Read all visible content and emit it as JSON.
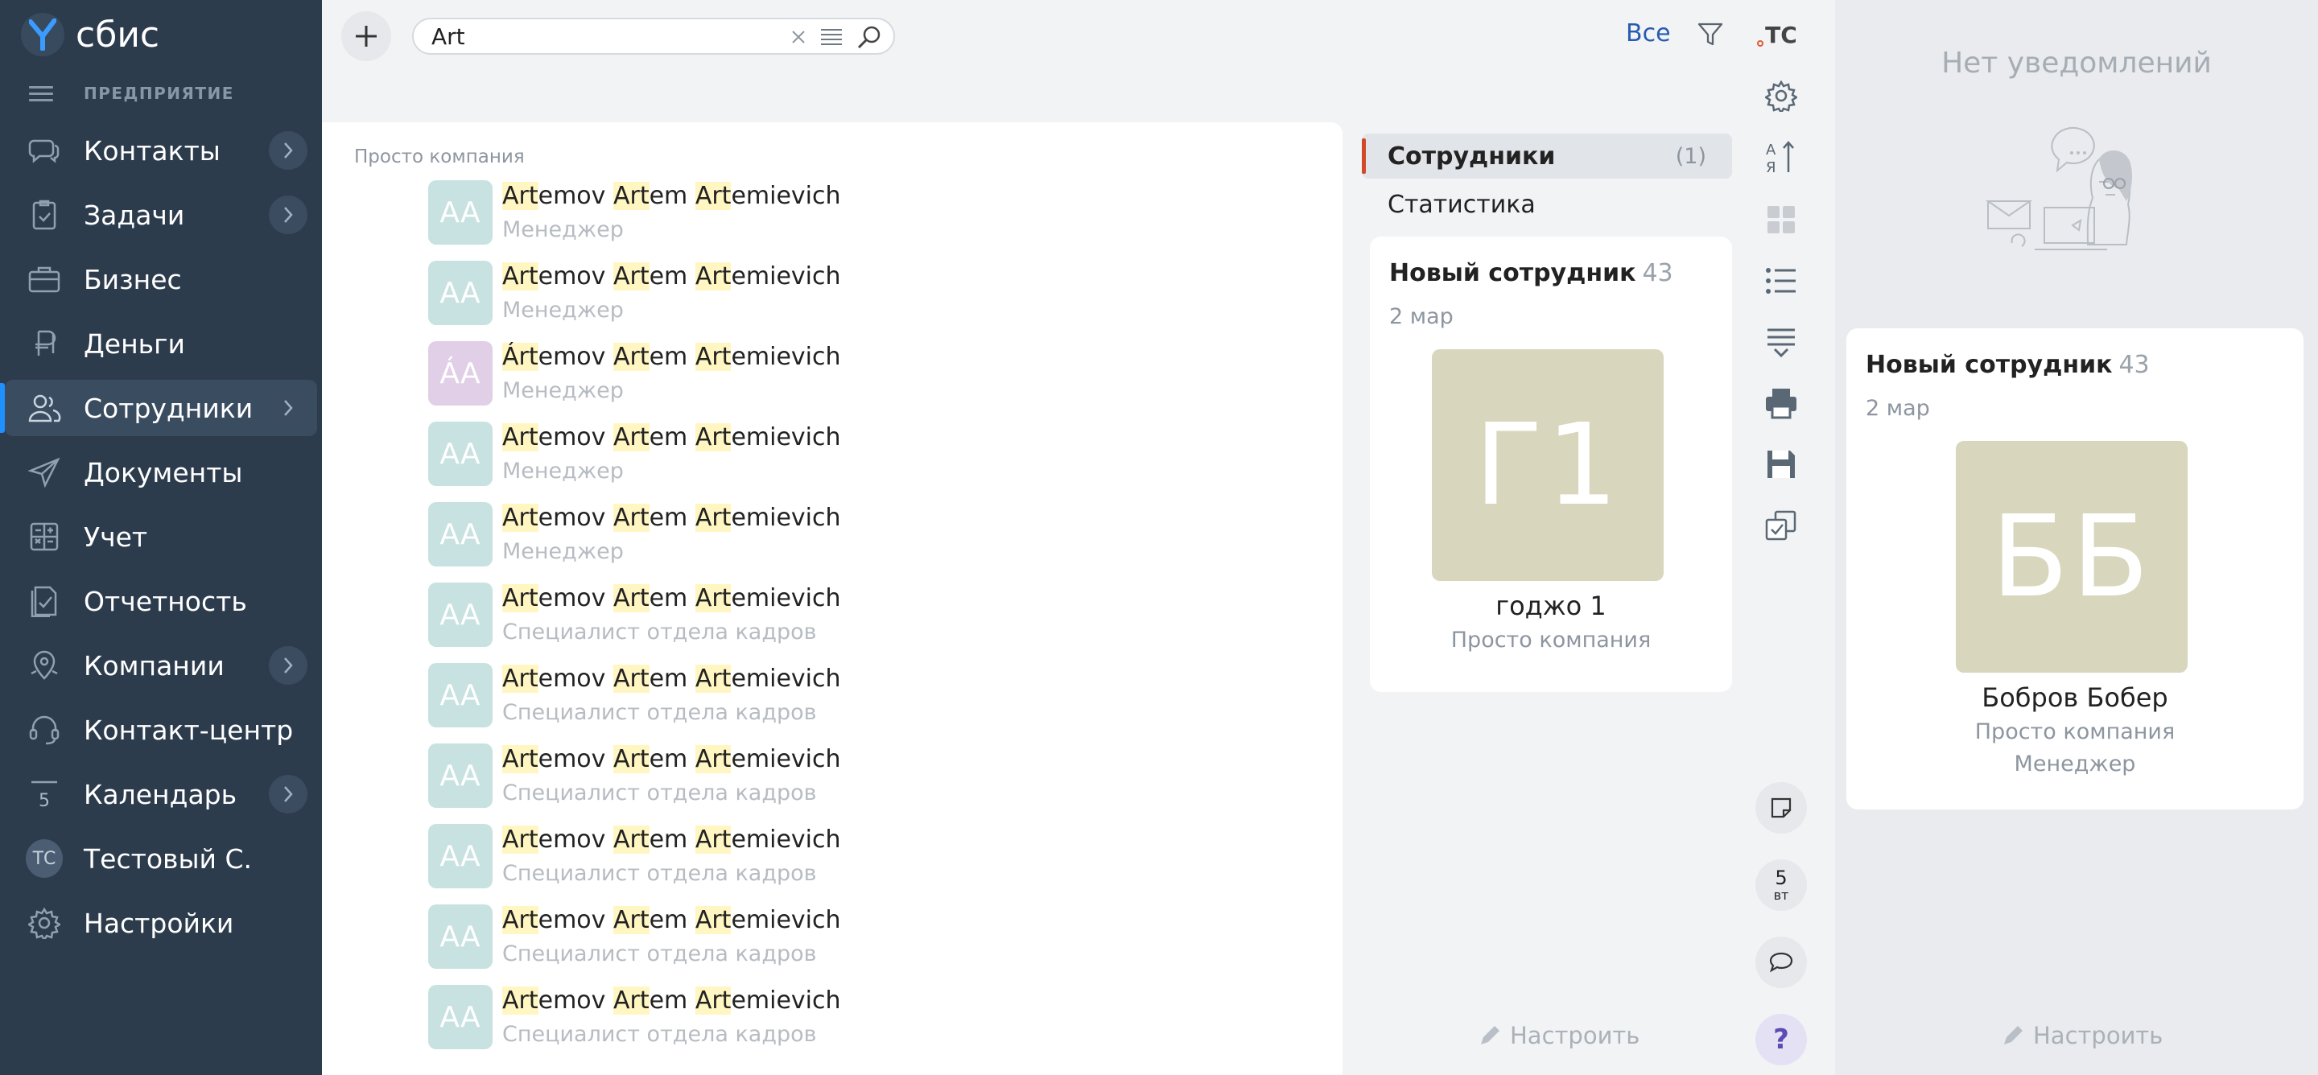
{
  "app": {
    "logo_text": "сбис",
    "org_label": "ПРЕДПРИЯТИЕ"
  },
  "sidebar": {
    "items": [
      {
        "label": "Контакты",
        "icon": "chat-bubbles-icon",
        "chevron": true
      },
      {
        "label": "Задачи",
        "icon": "task-clipboard-icon",
        "chevron": true
      },
      {
        "label": "Бизнес",
        "icon": "briefcase-icon",
        "chevron": false
      },
      {
        "label": "Деньги",
        "icon": "ruble-icon",
        "chevron": false
      },
      {
        "label": "Сотрудники",
        "icon": "employees-icon",
        "chevron": true,
        "active": true
      },
      {
        "label": "Документы",
        "icon": "paper-plane-icon",
        "chevron": false
      },
      {
        "label": "Учет",
        "icon": "calculator-icon",
        "chevron": false
      },
      {
        "label": "Отчетность",
        "icon": "report-check-icon",
        "chevron": false
      },
      {
        "label": "Компании",
        "icon": "map-pin-icon",
        "chevron": true
      },
      {
        "label": "Контакт-центр",
        "icon": "headset-icon",
        "chevron": false
      },
      {
        "label": "Календарь",
        "icon": "calendar-icon",
        "chevron": true,
        "icon_text": "5"
      },
      {
        "label": "Тестовый С.",
        "icon": "avatar",
        "chevron": false,
        "icon_text": "ТС"
      },
      {
        "label": "Настройки",
        "icon": "gear-icon",
        "chevron": false
      }
    ]
  },
  "search": {
    "value": "Art",
    "filter_label": "Все"
  },
  "results": {
    "group_title": "Просто компания",
    "rows": [
      {
        "initials": "АА",
        "first": "Art",
        "first_rest": "emov",
        "mid": "Art",
        "mid_rest": "em",
        "last": "Art",
        "last_rest": "emievich",
        "position": "Менеджер",
        "purple": false
      },
      {
        "initials": "АА",
        "first": "Art",
        "first_rest": "emov",
        "mid": "Art",
        "mid_rest": "em",
        "last": "Art",
        "last_rest": "emievich",
        "position": "Менеджер",
        "purple": false
      },
      {
        "initials": "ÁА",
        "first": "Árt",
        "first_rest": "emov",
        "mid": "Art",
        "mid_rest": "em",
        "last": "Art",
        "last_rest": "emievich",
        "position": "Менеджер",
        "purple": true
      },
      {
        "initials": "АА",
        "first": "Art",
        "first_rest": "emov",
        "mid": "Art",
        "mid_rest": "em",
        "last": "Art",
        "last_rest": "emievich",
        "position": "Менеджер",
        "purple": false
      },
      {
        "initials": "АА",
        "first": "Art",
        "first_rest": "emov",
        "mid": "Art",
        "mid_rest": "em",
        "last": "Art",
        "last_rest": "emievich",
        "position": "Менеджер",
        "purple": false
      },
      {
        "initials": "АА",
        "first": "Art",
        "first_rest": "emov",
        "mid": "Art",
        "mid_rest": "em",
        "last": "Art",
        "last_rest": "emievich",
        "position": "Специалист отдела кадров",
        "purple": false
      },
      {
        "initials": "АА",
        "first": "Art",
        "first_rest": "emov",
        "mid": "Art",
        "mid_rest": "em",
        "last": "Art",
        "last_rest": "emievich",
        "position": "Специалист отдела кадров",
        "purple": false
      },
      {
        "initials": "АА",
        "first": "Art",
        "first_rest": "emov",
        "mid": "Art",
        "mid_rest": "em",
        "last": "Art",
        "last_rest": "emievich",
        "position": "Специалист отдела кадров",
        "purple": false
      },
      {
        "initials": "АА",
        "first": "Art",
        "first_rest": "emov",
        "mid": "Art",
        "mid_rest": "em",
        "last": "Art",
        "last_rest": "emievich",
        "position": "Специалист отдела кадров",
        "purple": false
      },
      {
        "initials": "АА",
        "first": "Art",
        "first_rest": "emov",
        "mid": "Art",
        "mid_rest": "em",
        "last": "Art",
        "last_rest": "emievich",
        "position": "Специалист отдела кадров",
        "purple": false
      },
      {
        "initials": "АА",
        "first": "Art",
        "first_rest": "emov",
        "mid": "Art",
        "mid_rest": "em",
        "last": "Art",
        "last_rest": "emievich",
        "position": "Специалист отдела кадров",
        "purple": false
      }
    ]
  },
  "facets": {
    "employees_label": "Сотрудники",
    "employees_count": "(1)",
    "stats_label": "Статистика"
  },
  "new_employee_card": {
    "title": "Новый сотрудник",
    "count": "43",
    "date": "2 мар",
    "photo_initials": "Г1",
    "name": "годжо 1",
    "company": "Просто компания"
  },
  "configure_label": "Настроить",
  "toolbar": {
    "user_initials": "ТС",
    "date_day": "5",
    "date_weekday": "вт",
    "help_label": "?"
  },
  "notifications": {
    "empty_label": "Нет уведомлений",
    "card": {
      "title": "Новый сотрудник",
      "count": "43",
      "date": "2 мар",
      "photo_initials": "ББ",
      "name": "Бобров Бобер",
      "company": "Просто компания",
      "position": "Менеджер"
    },
    "configure_label": "Настроить"
  },
  "colors": {
    "sidebar_bg": "#2d3c4d",
    "accent_blue": "#1e90ff",
    "highlight": "#fff6c2",
    "facet_marker": "#d04a29",
    "avatar_teal": "#c7e2e0",
    "avatar_purple": "#e0cfe6",
    "photo_beige": "#d8d7bd"
  }
}
